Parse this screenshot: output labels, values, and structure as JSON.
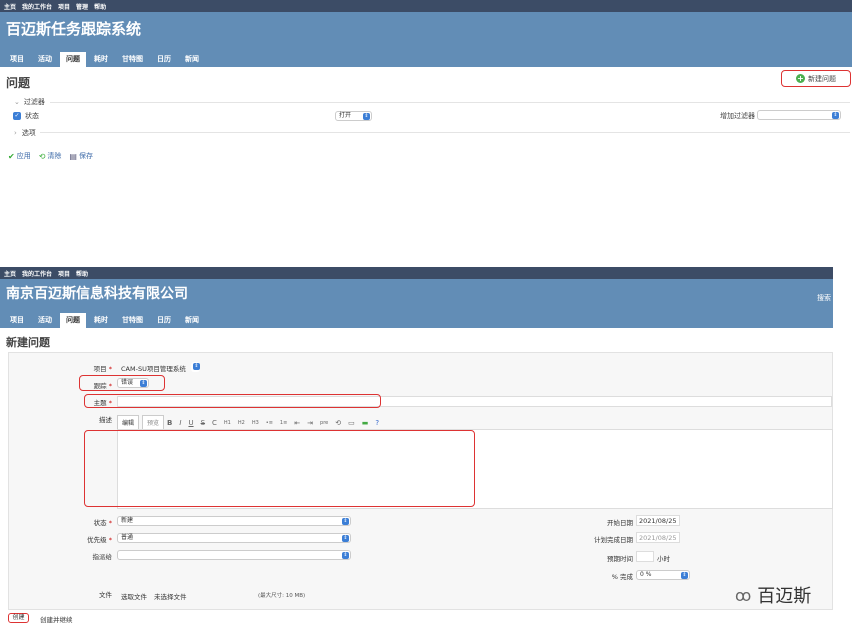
{
  "top": {
    "menu": [
      "主页",
      "我的工作台",
      "项目",
      "管理",
      "帮助"
    ],
    "title": "百迈斯任务跟踪系统",
    "tabs": [
      "项目",
      "活动",
      "问题",
      "耗时",
      "甘特图",
      "日历",
      "新闻"
    ],
    "active_tab": "问题",
    "page_title": "问题",
    "new_issue": "新建问题",
    "filters_label": "过滤器",
    "status_label": "状态",
    "status_value": "打开",
    "add_filter_label": "增加过滤器",
    "options_label": "选项",
    "actions": {
      "apply": "应用",
      "clear": "清除",
      "save": "保存"
    }
  },
  "bottom": {
    "menu": [
      "主页",
      "我的工作台",
      "项目",
      "帮助"
    ],
    "title": "南京百迈斯信息科技有限公司",
    "search_label": "搜索",
    "tabs": [
      "项目",
      "活动",
      "问题",
      "耗时",
      "甘特图",
      "日历",
      "新闻"
    ],
    "active_tab": "问题",
    "page_title": "新建问题",
    "form": {
      "project_label": "项目",
      "project_value": "CAM-SU项目管理系统",
      "tracker_label": "跟踪",
      "tracker_value": "错误",
      "subject_label": "主题",
      "desc_label": "描述",
      "editor_tabs": [
        "编辑",
        "预览"
      ],
      "toolbar_icons": [
        "B",
        "I",
        "U",
        "S",
        "C",
        "H1",
        "H2",
        "H3",
        "•≡",
        "1≡",
        "⇤",
        "⇥",
        "pre",
        "⟲",
        "▭",
        "▬",
        "?"
      ],
      "status_label": "状态",
      "status_value": "新建",
      "priority_label": "优先级",
      "priority_value": "普通",
      "assignee_label": "指派给",
      "assignee_value": "",
      "start_label": "开始日期",
      "start_value": "2021/08/25",
      "due_label": "计划完成日期",
      "due_value": "2021/08/25",
      "estimate_label": "预期时间",
      "estimate_unit": "小时",
      "done_label": "% 完成",
      "done_value": "0 %",
      "file_label": "文件",
      "choose_file": "选取文件",
      "no_file": "未选择文件",
      "max_size": "(最大尺寸: 10 MB)",
      "create": "创建",
      "create_continue": "创建并继续"
    }
  },
  "watermark": "百迈斯",
  "colors": {
    "header": "#628db6",
    "topbar": "#3c4c66",
    "highlight": "#dd3333",
    "select_arrow": "#3b7ed6"
  }
}
